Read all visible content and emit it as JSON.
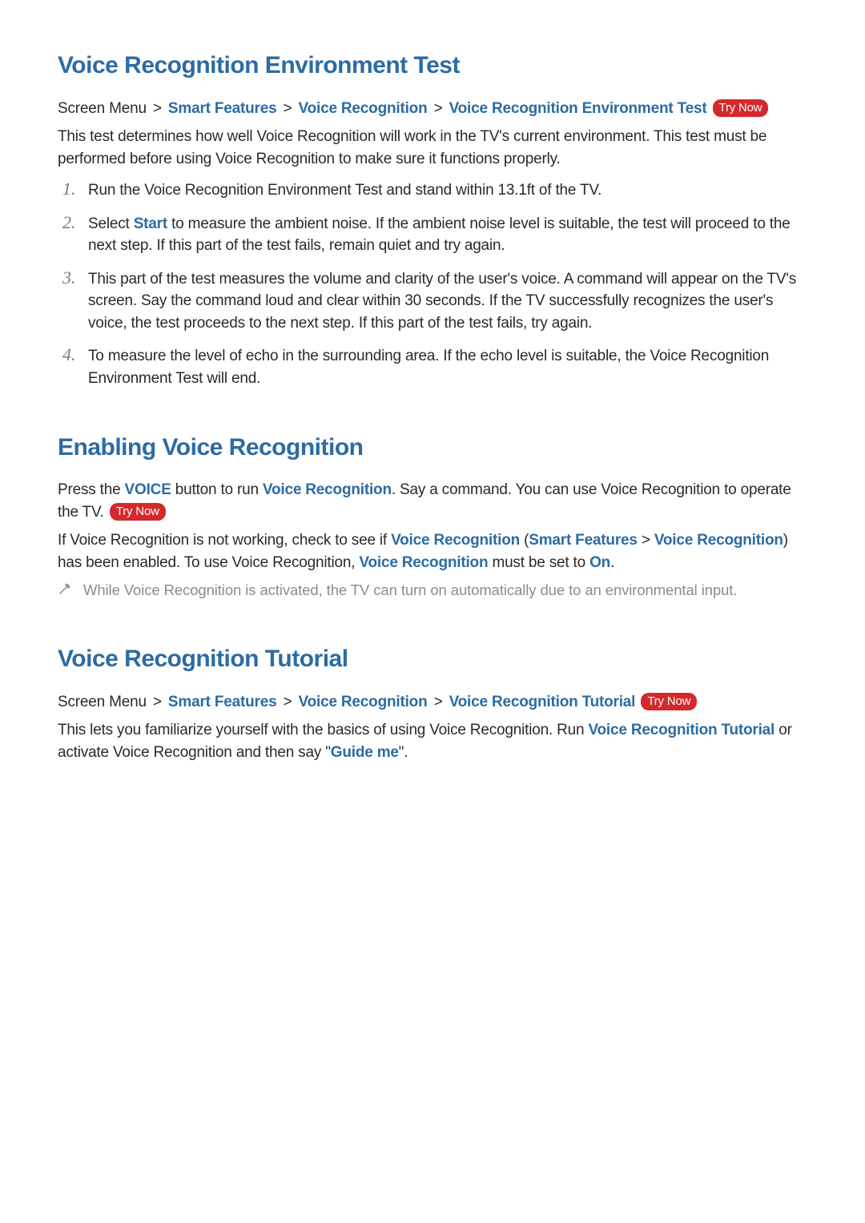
{
  "section1": {
    "title": "Voice Recognition Environment Test",
    "bc_prefix": "Screen Menu",
    "bc_smart": "Smart Features",
    "bc_voice": "Voice Recognition",
    "bc_leaf": "Voice Recognition Environment Test",
    "try_now": "Try Now",
    "intro": "This test determines how well Voice Recognition will work in the TV's current environment. This test must be performed before using Voice Recognition to make sure it functions properly.",
    "steps": {
      "s1": "Run the Voice Recognition Environment Test and stand within 13.1ft of the TV.",
      "s2a": "Select ",
      "s2_start": "Start",
      "s2b": " to measure the ambient noise. If the ambient noise level is suitable, the test will proceed to the next step. If this part of the test fails, remain quiet and try again.",
      "s3": "This part of the test measures the volume and clarity of the user's voice. A command will appear on the TV's screen. Say the command loud and clear within 30 seconds. If the TV successfully recognizes the user's voice, the test proceeds to the next step. If this part of the test fails, try again.",
      "s4": "To measure the level of echo in the surrounding area. If the echo level is suitable, the Voice Recognition Environment Test will end."
    }
  },
  "section2": {
    "title": "Enabling Voice Recognition",
    "p1_a": "Press the ",
    "p1_voice": "VOICE",
    "p1_b": " button to run ",
    "p1_vr": "Voice Recognition",
    "p1_c": ". Say a command. You can use Voice Recognition to operate the TV. ",
    "try_now": "Try Now",
    "p2_a": "If Voice Recognition is not working, check to see if ",
    "p2_vr1": "Voice Recognition",
    "p2_b": " (",
    "p2_smart": "Smart Features",
    "p2_c": " > ",
    "p2_vr2": "Voice Recognition",
    "p2_d": ") has been enabled. To use Voice Recognition, ",
    "p2_vr3": "Voice Recognition",
    "p2_e": " must be set to ",
    "p2_on": "On",
    "p2_f": ".",
    "note": "While Voice Recognition is activated, the TV can turn on automatically due to an environmental input."
  },
  "section3": {
    "title": "Voice Recognition Tutorial",
    "bc_prefix": "Screen Menu",
    "bc_smart": "Smart Features",
    "bc_voice": "Voice Recognition",
    "bc_leaf": "Voice Recognition Tutorial",
    "try_now": "Try Now",
    "p_a": "This lets you familiarize yourself with the basics of using Voice Recognition. Run ",
    "p_vrt": "Voice Recognition Tutorial",
    "p_b": " or activate Voice Recognition and then say \"",
    "p_guide": "Guide me",
    "p_c": "\"."
  }
}
